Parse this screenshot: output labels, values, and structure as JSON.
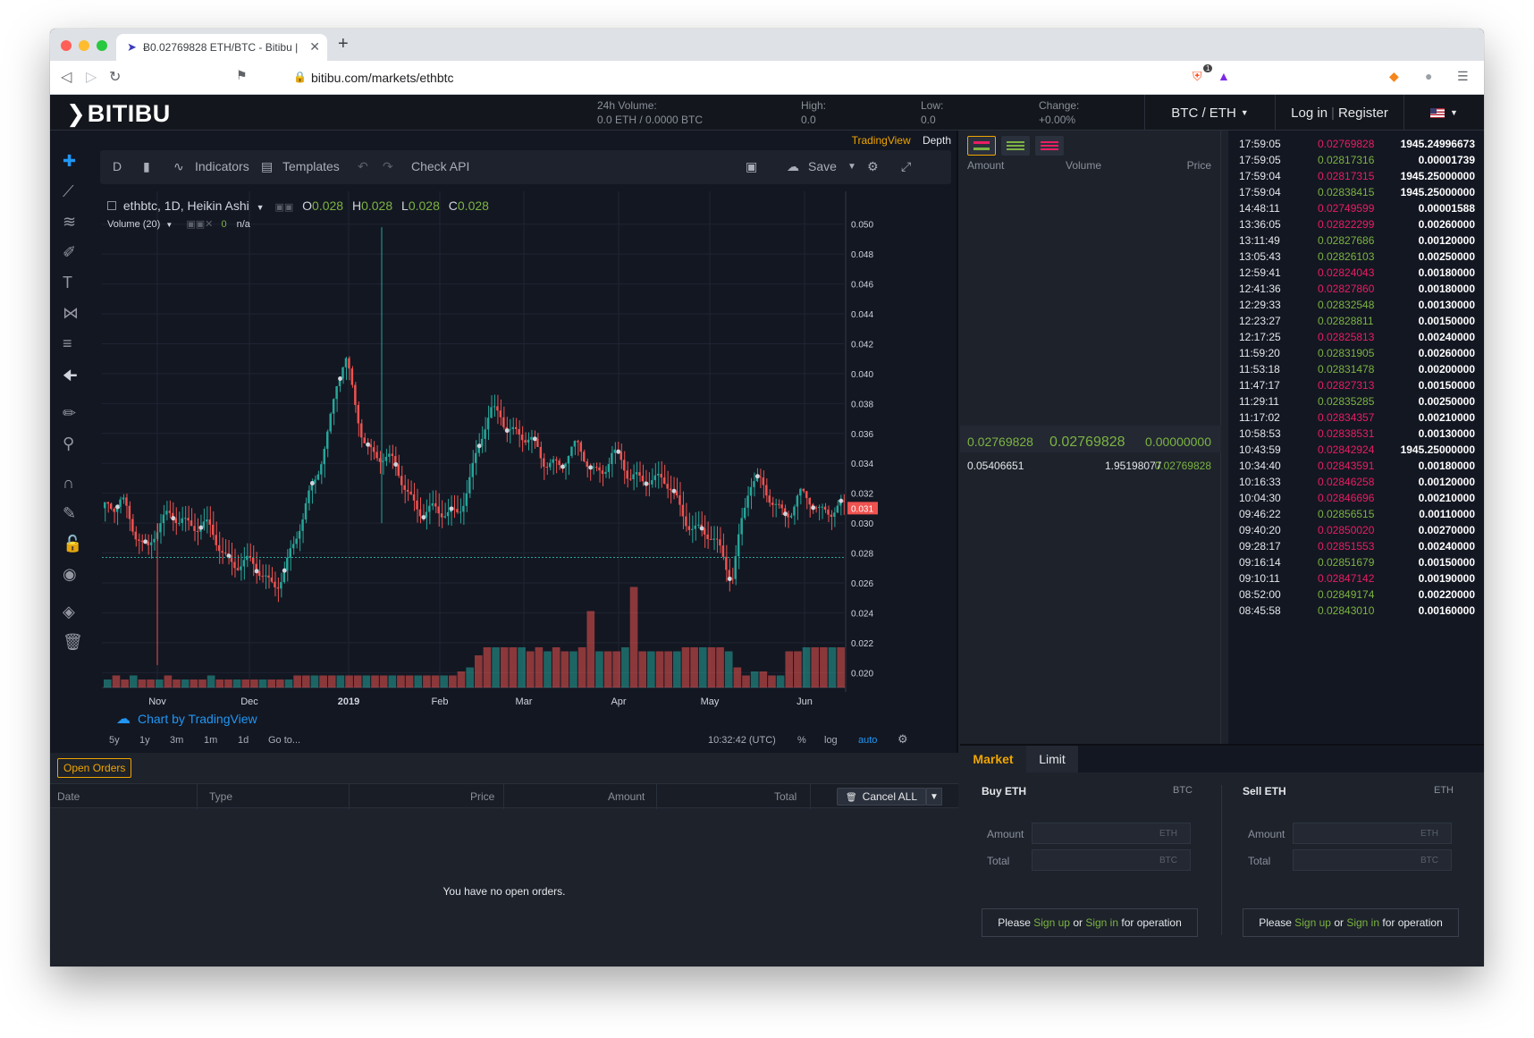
{
  "browser": {
    "tab_title": "Ƀ0.02769828 ETH/BTC - Bitibu | ",
    "url": "bitibu.com/markets/ethbtc",
    "new_tab_label": "+",
    "brave_badge": "1"
  },
  "header": {
    "logo": "BITIBU",
    "stats": [
      {
        "label": "24h Volume:",
        "value": "0.0 ETH / 0.0000 BTC"
      },
      {
        "label": "High:",
        "value": "0.0"
      },
      {
        "label": "Low:",
        "value": "0.0"
      },
      {
        "label": "Change:",
        "value": "+0.00%"
      }
    ],
    "market_selector": "BTC / ETH",
    "login": "Log in",
    "register": "Register"
  },
  "chart": {
    "view_tabs": {
      "tradingview": "TradingView",
      "depth": "Depth"
    },
    "toolbar": {
      "interval": "D",
      "indicators": "Indicators",
      "templates": "Templates",
      "check_api": "Check API",
      "save": "Save"
    },
    "legend": {
      "symbol": "ethbtc, 1D, Heikin Ashi",
      "o_label": "O",
      "o": "0.028",
      "h_label": "H",
      "h": "0.028",
      "l_label": "L",
      "l": "0.028",
      "c_label": "C",
      "c": "0.028",
      "volume": "Volume (20)",
      "vol_value": "0",
      "vol_na": "n/a"
    },
    "watermark": "Chart by TradingView",
    "price_label": "0.031",
    "y_ticks": [
      "0.050",
      "0.048",
      "0.046",
      "0.044",
      "0.042",
      "0.040",
      "0.038",
      "0.036",
      "0.034",
      "0.032",
      "0.030",
      "0.028",
      "0.026",
      "0.024",
      "0.022",
      "0.020"
    ],
    "x_ticks": [
      "Nov",
      "Dec",
      "2019",
      "Feb",
      "Mar",
      "Apr",
      "May",
      "Jun"
    ],
    "ranges": [
      "5y",
      "1y",
      "3m",
      "1m",
      "1d"
    ],
    "goto": "Go to...",
    "time": "10:32:42 (UTC)",
    "percent": "%",
    "log": "log",
    "auto": "auto"
  },
  "chart_data": {
    "type": "candlestick",
    "title": "ethbtc, 1D, Heikin Ashi",
    "x_ticks": [
      "Nov",
      "Dec",
      "2019",
      "Feb",
      "Mar",
      "Apr",
      "May",
      "Jun"
    ],
    "ylim": [
      0.019,
      0.051
    ],
    "close_series": [
      0.031,
      0.0305,
      0.0312,
      0.0302,
      0.0296,
      0.0284,
      0.0292,
      0.0298,
      0.0305,
      0.0308,
      0.0302,
      0.0296,
      0.0292,
      0.0286,
      0.0281,
      0.0278,
      0.0274,
      0.0268,
      0.0264,
      0.0262,
      0.0265,
      0.0272,
      0.0282,
      0.0298,
      0.0322,
      0.0345,
      0.0365,
      0.0392,
      0.0405,
      0.038,
      0.0362,
      0.0352,
      0.0345,
      0.0338,
      0.0332,
      0.0325,
      0.0318,
      0.031,
      0.0305,
      0.0302,
      0.0306,
      0.0312,
      0.0324,
      0.0338,
      0.0356,
      0.0372,
      0.0378,
      0.0368,
      0.036,
      0.0352,
      0.0348,
      0.0344,
      0.0346,
      0.0341,
      0.0343,
      0.0346,
      0.0342,
      0.0339,
      0.034,
      0.0344,
      0.0337,
      0.0328,
      0.0334,
      0.0336,
      0.0329,
      0.0324,
      0.0318,
      0.031,
      0.0305,
      0.0298,
      0.029,
      0.0282,
      0.0276,
      0.0268,
      0.0302,
      0.0325,
      0.0322,
      0.0318,
      0.0316,
      0.0312,
      0.031,
      0.0314,
      0.0312,
      0.0309,
      0.0315,
      0.0312,
      0.0308
    ],
    "volume_series": [
      0.2,
      0.3,
      0.2,
      0.3,
      0.2,
      0.2,
      0.2,
      0.3,
      0.2,
      0.2,
      0.2,
      0.2,
      0.3,
      0.2,
      0.2,
      0.2,
      0.2,
      0.2,
      0.2,
      0.2,
      0.2,
      0.2,
      0.3,
      0.3,
      0.3,
      0.3,
      0.3,
      0.3,
      0.3,
      0.3,
      0.3,
      0.3,
      0.3,
      0.3,
      0.3,
      0.3,
      0.3,
      0.3,
      0.3,
      0.3,
      0.3,
      0.4,
      0.5,
      0.8,
      1.0,
      1.0,
      1.0,
      1.0,
      1.0,
      0.9,
      1.0,
      0.9,
      1.0,
      0.9,
      0.9,
      1.0,
      1.9,
      0.9,
      0.9,
      0.9,
      1.0,
      2.5,
      0.9,
      0.9,
      0.9,
      0.9,
      0.9,
      1.0,
      1.0,
      1.0,
      1.0,
      1.0,
      0.9,
      0.5,
      0.3,
      0.4,
      0.4,
      0.3,
      0.3,
      0.9,
      0.9,
      1.0,
      1.0,
      1.0,
      1.0,
      1.0
    ]
  },
  "orderbook": {
    "col_amount": "Amount",
    "col_volume": "Volume",
    "col_price": "Price",
    "last": [
      "0.02769828",
      "0.02769828",
      "0.00000000"
    ],
    "row": [
      "0.05406651",
      "1.95198077",
      "0.02769828"
    ]
  },
  "trades": [
    {
      "time": "17:59:05",
      "price": "0.02769828",
      "amount": "1945.24996673",
      "side": "sell"
    },
    {
      "time": "17:59:05",
      "price": "0.02817316",
      "amount": "0.00001739",
      "side": "buy"
    },
    {
      "time": "17:59:04",
      "price": "0.02817315",
      "amount": "1945.25000000",
      "side": "sell"
    },
    {
      "time": "17:59:04",
      "price": "0.02838415",
      "amount": "1945.25000000",
      "side": "buy"
    },
    {
      "time": "14:48:11",
      "price": "0.02749599",
      "amount": "0.00001588",
      "side": "sell"
    },
    {
      "time": "13:36:05",
      "price": "0.02822299",
      "amount": "0.00260000",
      "side": "sell"
    },
    {
      "time": "13:11:49",
      "price": "0.02827686",
      "amount": "0.00120000",
      "side": "buy"
    },
    {
      "time": "13:05:43",
      "price": "0.02826103",
      "amount": "0.00250000",
      "side": "buy"
    },
    {
      "time": "12:59:41",
      "price": "0.02824043",
      "amount": "0.00180000",
      "side": "sell"
    },
    {
      "time": "12:41:36",
      "price": "0.02827860",
      "amount": "0.00180000",
      "side": "sell"
    },
    {
      "time": "12:29:33",
      "price": "0.02832548",
      "amount": "0.00130000",
      "side": "buy"
    },
    {
      "time": "12:23:27",
      "price": "0.02828811",
      "amount": "0.00150000",
      "side": "buy"
    },
    {
      "time": "12:17:25",
      "price": "0.02825813",
      "amount": "0.00240000",
      "side": "sell"
    },
    {
      "time": "11:59:20",
      "price": "0.02831905",
      "amount": "0.00260000",
      "side": "buy"
    },
    {
      "time": "11:53:18",
      "price": "0.02831478",
      "amount": "0.00200000",
      "side": "buy"
    },
    {
      "time": "11:47:17",
      "price": "0.02827313",
      "amount": "0.00150000",
      "side": "sell"
    },
    {
      "time": "11:29:11",
      "price": "0.02835285",
      "amount": "0.00250000",
      "side": "buy"
    },
    {
      "time": "11:17:02",
      "price": "0.02834357",
      "amount": "0.00210000",
      "side": "sell"
    },
    {
      "time": "10:58:53",
      "price": "0.02838531",
      "amount": "0.00130000",
      "side": "sell"
    },
    {
      "time": "10:43:59",
      "price": "0.02842924",
      "amount": "1945.25000000",
      "side": "sell"
    },
    {
      "time": "10:34:40",
      "price": "0.02843591",
      "amount": "0.00180000",
      "side": "sell"
    },
    {
      "time": "10:16:33",
      "price": "0.02846258",
      "amount": "0.00120000",
      "side": "sell"
    },
    {
      "time": "10:04:30",
      "price": "0.02846696",
      "amount": "0.00210000",
      "side": "sell"
    },
    {
      "time": "09:46:22",
      "price": "0.02856515",
      "amount": "0.00110000",
      "side": "buy"
    },
    {
      "time": "09:40:20",
      "price": "0.02850020",
      "amount": "0.00270000",
      "side": "sell"
    },
    {
      "time": "09:28:17",
      "price": "0.02851553",
      "amount": "0.00240000",
      "side": "sell"
    },
    {
      "time": "09:16:14",
      "price": "0.02851679",
      "amount": "0.00150000",
      "side": "buy"
    },
    {
      "time": "09:10:11",
      "price": "0.02847142",
      "amount": "0.00190000",
      "side": "sell"
    },
    {
      "time": "08:52:00",
      "price": "0.02849174",
      "amount": "0.00220000",
      "side": "buy"
    },
    {
      "time": "08:45:58",
      "price": "0.02843010",
      "amount": "0.00160000",
      "side": "buy"
    }
  ],
  "orders": {
    "tab": "Open Orders",
    "cols": {
      "date": "Date",
      "type": "Type",
      "price": "Price",
      "amount": "Amount",
      "total": "Total"
    },
    "cancel_all": "Cancel ALL",
    "empty": "You have no open orders."
  },
  "tradeform": {
    "tab_market": "Market",
    "tab_limit": "Limit",
    "buy": {
      "title": "Buy ETH",
      "currency": "BTC",
      "amount_label": "Amount",
      "amount_ph": "ETH",
      "total_label": "Total",
      "total_ph": "BTC"
    },
    "sell": {
      "title": "Sell ETH",
      "currency": "ETH",
      "amount_label": "Amount",
      "amount_ph": "ETH",
      "total_label": "Total",
      "total_ph": "BTC"
    },
    "please": "Please",
    "sign_up": "Sign up",
    "or": "or",
    "sign_in": "Sign in",
    "for_op": "for operation"
  },
  "colors": {
    "up": "#26a69a",
    "down": "#ef5350",
    "buy_text": "#7cb342",
    "sell_text": "#e91e63",
    "accent": "#f0a500"
  }
}
